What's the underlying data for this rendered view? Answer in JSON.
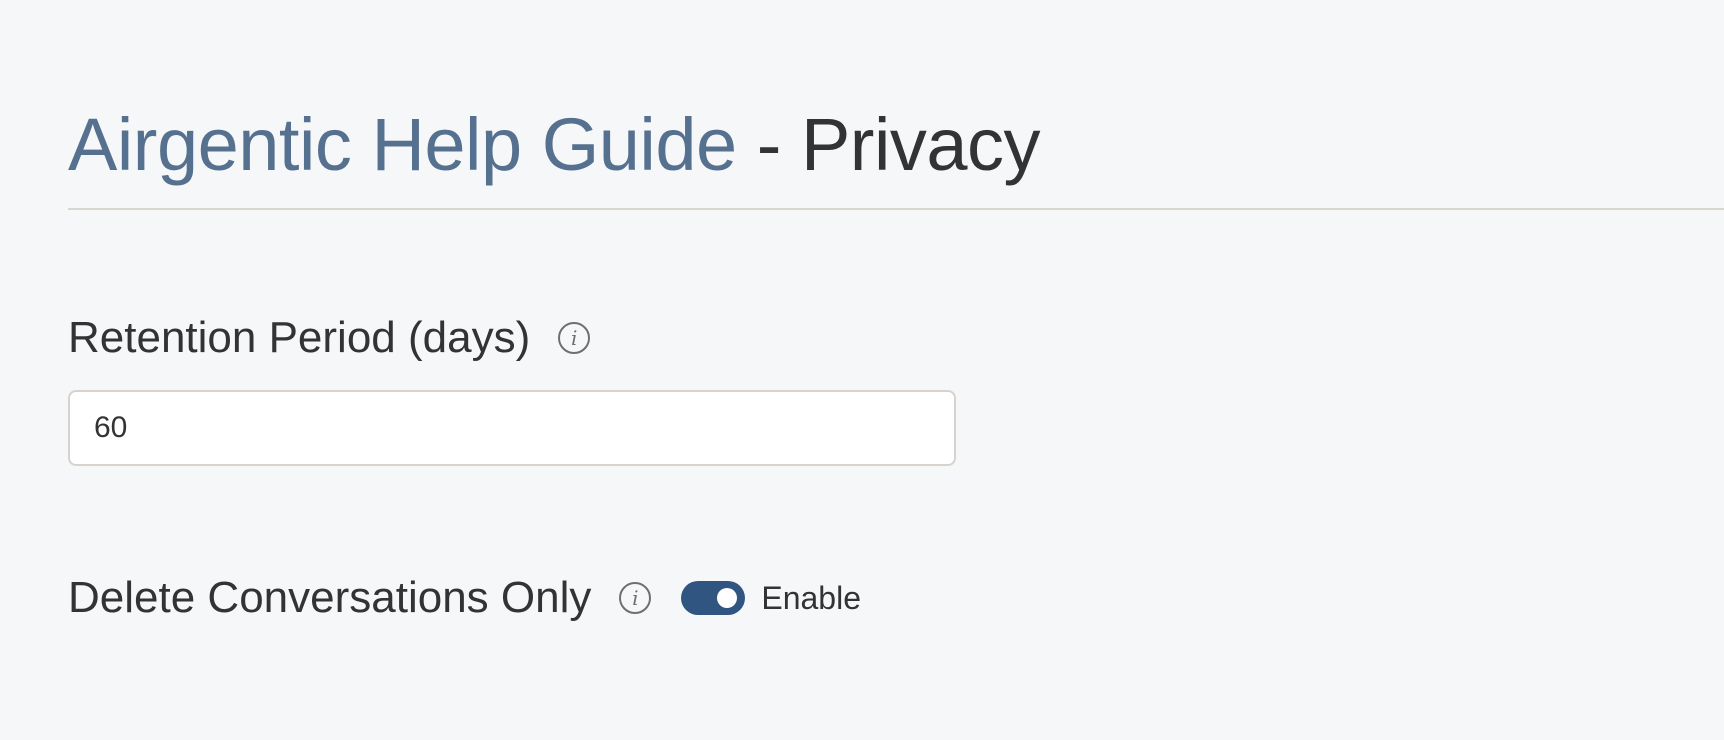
{
  "header": {
    "brand": "Airgentic Help Guide",
    "separator": " - ",
    "section": "Privacy"
  },
  "retention": {
    "label": "Retention Period (days)",
    "info_icon": "info-icon",
    "value": "60"
  },
  "delete_conversations": {
    "label": "Delete Conversations Only",
    "info_icon": "info-icon",
    "toggle_state": "on",
    "toggle_label": "Enable"
  },
  "colors": {
    "background": "#f6f7f9",
    "brand": "#56718f",
    "toggle_on": "#2f5580",
    "text": "#333333",
    "border": "#d7d2cb"
  }
}
